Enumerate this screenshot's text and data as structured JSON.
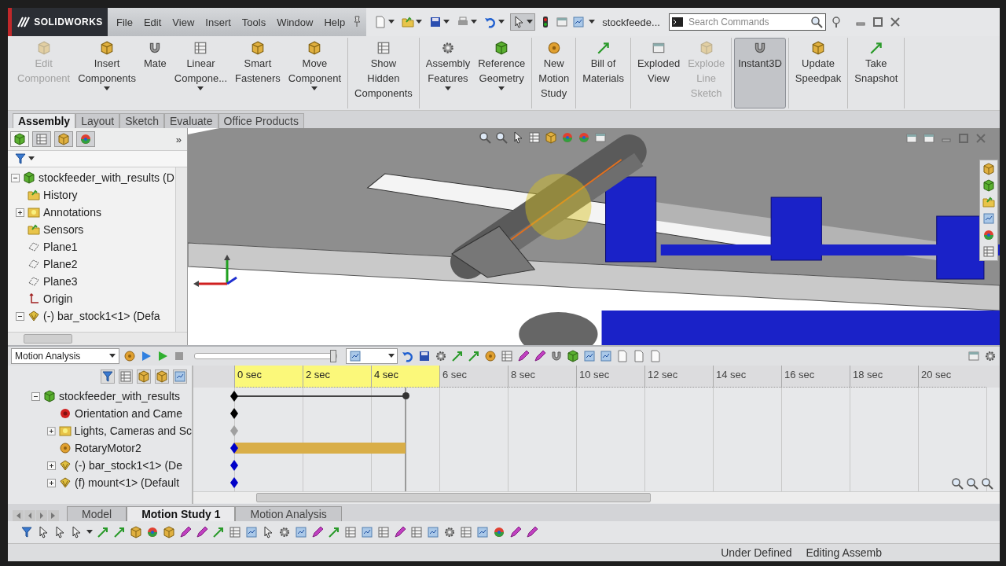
{
  "title_bar": {
    "logo": "SOLIDWORKS",
    "menu": [
      "File",
      "Edit",
      "View",
      "Insert",
      "Tools",
      "Window",
      "Help"
    ],
    "document": "stockfeede...",
    "search": {
      "placeholder": "Search Commands"
    }
  },
  "ribbon": {
    "groups": [
      [
        {
          "label": "Edit\nComponent",
          "disabled": true,
          "pressed": false,
          "dropdown": false
        },
        {
          "label": "Insert\nComponents",
          "disabled": false,
          "pressed": false,
          "dropdown": true
        },
        {
          "label": "Mate",
          "disabled": false,
          "pressed": false,
          "dropdown": false
        },
        {
          "label": "Linear\nCompone...",
          "disabled": false,
          "pressed": false,
          "dropdown": true
        },
        {
          "label": "Smart\nFasteners",
          "disabled": false,
          "pressed": false,
          "dropdown": false
        },
        {
          "label": "Move\nComponent",
          "disabled": false,
          "pressed": false,
          "dropdown": true
        }
      ],
      [
        {
          "label": "Show\nHidden\nComponents",
          "disabled": false,
          "pressed": false,
          "dropdown": false
        }
      ],
      [
        {
          "label": "Assembly\nFeatures",
          "disabled": false,
          "pressed": false,
          "dropdown": true
        },
        {
          "label": "Reference\nGeometry",
          "disabled": false,
          "pressed": false,
          "dropdown": true
        }
      ],
      [
        {
          "label": "New\nMotion\nStudy",
          "disabled": false,
          "pressed": false,
          "dropdown": false
        }
      ],
      [
        {
          "label": "Bill of\nMaterials",
          "disabled": false,
          "pressed": false,
          "dropdown": false
        }
      ],
      [
        {
          "label": "Exploded\nView",
          "disabled": false,
          "pressed": false,
          "dropdown": false
        },
        {
          "label": "Explode\nLine\nSketch",
          "disabled": true,
          "pressed": false,
          "dropdown": false
        }
      ],
      [
        {
          "label": "Instant3D",
          "disabled": false,
          "pressed": true,
          "dropdown": false
        }
      ],
      [
        {
          "label": "Update\nSpeedpak",
          "disabled": false,
          "pressed": false,
          "dropdown": false
        }
      ],
      [
        {
          "label": "Take\nSnapshot",
          "disabled": false,
          "pressed": false,
          "dropdown": false
        }
      ]
    ]
  },
  "command_tabs": [
    {
      "label": "Assembly",
      "selected": true
    },
    {
      "label": "Layout",
      "selected": false
    },
    {
      "label": "Sketch",
      "selected": false
    },
    {
      "label": "Evaluate",
      "selected": false
    },
    {
      "label": "Office Products",
      "selected": false
    }
  ],
  "feature_tree": {
    "more": "»",
    "items": [
      {
        "label": "stockfeeder_with_results  (D",
        "expanded": true,
        "children": [
          {
            "label": "History"
          },
          {
            "label": "Annotations",
            "expanded": false
          },
          {
            "label": "Sensors"
          },
          {
            "label": "Plane1"
          },
          {
            "label": "Plane2"
          },
          {
            "label": "Plane3"
          },
          {
            "label": "Origin"
          },
          {
            "label": "(-) bar_stock1<1> (Defa",
            "expanded": true
          }
        ]
      }
    ]
  },
  "motion_study": {
    "study_type": "Motion Analysis",
    "speed_slider": {
      "level": 0.97
    },
    "ticks": [
      {
        "label": "0 sec",
        "highlighted": true
      },
      {
        "label": "2 sec",
        "highlighted": true
      },
      {
        "label": "4 sec",
        "highlighted": true
      },
      {
        "label": "6 sec",
        "highlighted": false
      },
      {
        "label": "8 sec",
        "highlighted": false
      },
      {
        "label": "10 sec",
        "highlighted": false
      },
      {
        "label": "12 sec",
        "highlighted": false
      },
      {
        "label": "14 sec",
        "highlighted": false
      },
      {
        "label": "16 sec",
        "highlighted": false
      },
      {
        "label": "18 sec",
        "highlighted": false
      },
      {
        "label": "20 sec",
        "highlighted": false
      }
    ],
    "tree": [
      {
        "label": "stockfeeder_with_results",
        "expanded": true,
        "kind": "span",
        "color": "#000000",
        "children": [
          {
            "label": "Orientation and Came",
            "kind": "key",
            "color": "#000000"
          },
          {
            "label": "Lights, Cameras and Sc",
            "expanded": false,
            "kind": "key",
            "color": "#a0a0a0"
          },
          {
            "label": "RotaryMotor2",
            "kind": "motor",
            "color": "#0000c8"
          },
          {
            "label": "(-) bar_stock1<1> (De",
            "expanded": false,
            "kind": "key",
            "color": "#0000c8"
          },
          {
            "label": "(f) mount<1> (Default",
            "expanded": false,
            "kind": "key",
            "color": "#0000c8"
          }
        ]
      }
    ]
  },
  "bottom_tabs": [
    {
      "label": "Model",
      "selected": false
    },
    {
      "label": "Motion Study 1",
      "selected": true
    },
    {
      "label": "Motion Analysis",
      "selected": false
    }
  ],
  "status_bar": [
    "Under Defined",
    "Editing Assemb"
  ]
}
